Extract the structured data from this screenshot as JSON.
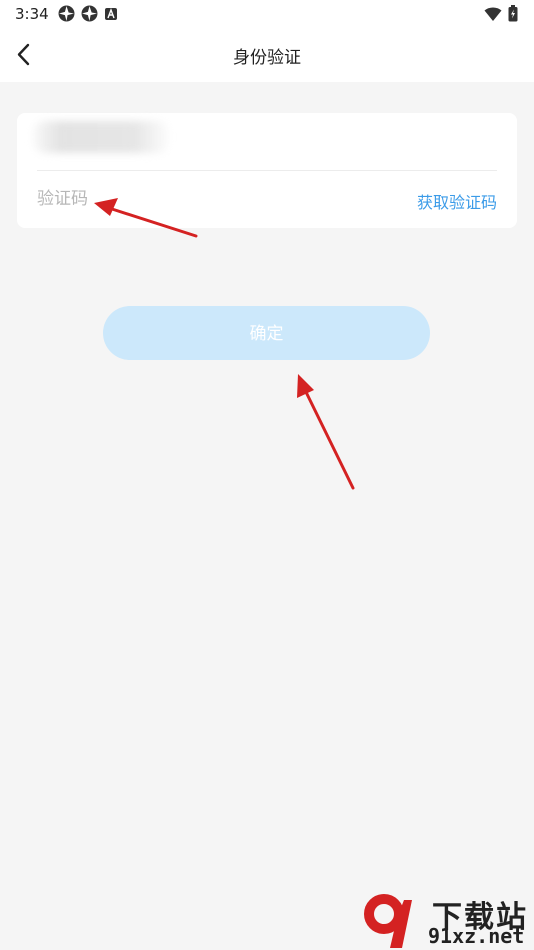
{
  "status_bar": {
    "time": "3:34",
    "icons": [
      "aperture-icon",
      "aperture-icon",
      "text-notification-icon"
    ],
    "right_icons": [
      "wifi-icon",
      "battery-icon"
    ]
  },
  "nav": {
    "title": "身份验证",
    "back_icon": "chevron-left-icon"
  },
  "form": {
    "phone_value": "",
    "code_placeholder": "验证码",
    "get_code_label": "获取验证码",
    "accent_color": "#3b9be8"
  },
  "confirm_button": {
    "label": "确定",
    "color": "#cce8fb"
  },
  "annotation": {
    "arrow_color": "#d42222"
  },
  "watermark": {
    "brand": "下载站",
    "site": "91xz.net"
  }
}
